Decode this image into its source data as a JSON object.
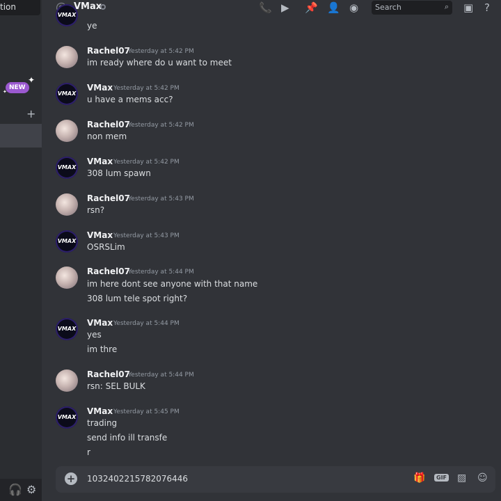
{
  "sidebar": {
    "top_text": "tion",
    "new_badge": "NEW",
    "add_icon": "plus-icon",
    "bottom_icons": [
      "headphones-icon",
      "gear-icon"
    ]
  },
  "header": {
    "at_symbol": "@",
    "title": "VMax",
    "icons": [
      "phone-call-icon",
      "video-call-icon",
      "pin-icon",
      "add-friend-icon",
      "profile-icon",
      "inbox-icon",
      "help-icon"
    ],
    "search_placeholder": "Search"
  },
  "messages": [
    {
      "user": "",
      "timestamp": "",
      "lines": [
        "ye"
      ]
    },
    {
      "user": "Rachel07",
      "timestamp": "Yesterday at 5:42 PM",
      "lines": [
        "im ready where do u want to meet"
      ]
    },
    {
      "user": "VMax",
      "timestamp": "Yesterday at 5:42 PM",
      "lines": [
        "u have a mems acc?"
      ]
    },
    {
      "user": "Rachel07",
      "timestamp": "Yesterday at 5:42 PM",
      "lines": [
        "non mem"
      ]
    },
    {
      "user": "VMax",
      "timestamp": "Yesterday at 5:42 PM",
      "lines": [
        "308 lum spawn"
      ]
    },
    {
      "user": "Rachel07",
      "timestamp": "Yesterday at 5:43 PM",
      "lines": [
        "rsn?"
      ]
    },
    {
      "user": "VMax",
      "timestamp": "Yesterday at 5:43 PM",
      "lines": [
        "OSRSLim"
      ]
    },
    {
      "user": "Rachel07",
      "timestamp": "Yesterday at 5:44 PM",
      "lines": [
        "im here  dont see anyone with that name",
        "308 lum tele spot right?"
      ]
    },
    {
      "user": "VMax",
      "timestamp": "Yesterday at 5:44 PM",
      "lines": [
        "yes",
        "im thre"
      ]
    },
    {
      "user": "Rachel07",
      "timestamp": "Yesterday at 5:44 PM",
      "lines": [
        "rsn: SEL BULK"
      ]
    },
    {
      "user": "VMax",
      "timestamp": "Yesterday at 5:45 PM",
      "lines": [
        "trading",
        "send info ill transfe",
        "r"
      ]
    }
  ],
  "vmax_avatar_text": "VMAX",
  "composer": {
    "value": "1032402215782076446",
    "gif_label": "GIF",
    "icons": [
      "add-attachment-icon",
      "gift-icon",
      "gif-icon",
      "sticker-icon",
      "emoji-icon"
    ]
  },
  "colors": {
    "background": "#313338",
    "sidebar": "#2b2d31",
    "composer": "#383a40",
    "badge": "#9b59d0"
  }
}
